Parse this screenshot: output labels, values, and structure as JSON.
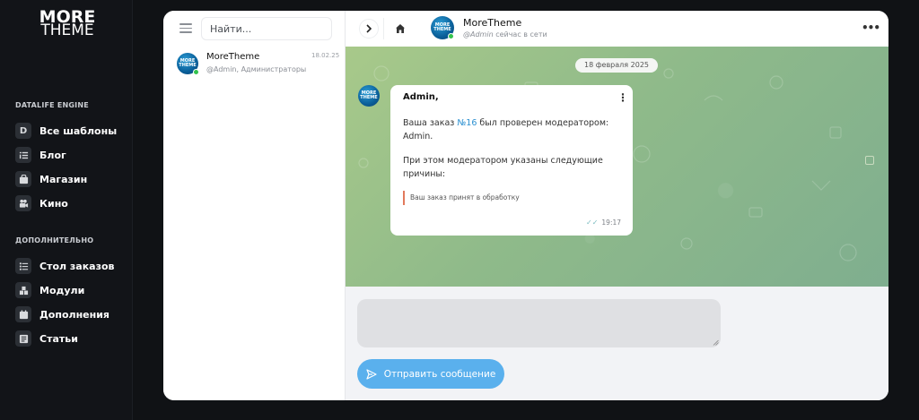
{
  "brand": {
    "logo_line1": "MORE",
    "logo_line2": "THEME"
  },
  "sidebar": {
    "section1_title": "DATALIFE ENGINE",
    "section1_items": [
      {
        "label": "Все шаблоны",
        "icon": "letter-d-icon",
        "glyph": "D"
      },
      {
        "label": "Блог",
        "icon": "list-icon"
      },
      {
        "label": "Магазин",
        "icon": "shop-icon"
      },
      {
        "label": "Кино",
        "icon": "video-camera-icon"
      }
    ],
    "section2_title": "ДОПОЛНИТЕЛЬНО",
    "section2_items": [
      {
        "label": "Стол заказов",
        "icon": "orders-list-icon"
      },
      {
        "label": "Модули",
        "icon": "modules-icon"
      },
      {
        "label": "Дополнения",
        "icon": "calendar-icon"
      },
      {
        "label": "Статьи",
        "icon": "article-icon"
      }
    ]
  },
  "chatlist": {
    "search_placeholder": "Найти...",
    "entries": [
      {
        "name": "MoreTheme",
        "subtitle": "@Admin, Администраторы",
        "time": "18.02.25",
        "avatar_text": "MORE THEME"
      }
    ]
  },
  "conversation": {
    "title": "MoreTheme",
    "status_user": "@Admin",
    "status_text": "сейчас в сети",
    "avatar_text": "MORE THEME",
    "date_separator": "18 февраля 2025",
    "messages": [
      {
        "from": "Admin,",
        "line1_pre": "Ваша заказ ",
        "order_link": "№16",
        "line1_post": " был проверен модератором: Admin.",
        "line2": "При этом модератором указаны следующие причины:",
        "quote": "Ваш заказ принят в обработку",
        "time": "19:17",
        "check": "✓✓"
      }
    ]
  },
  "composer": {
    "input_value": "",
    "send_label": "Отправить сообщение"
  },
  "colors": {
    "accent": "#5ab0ed",
    "online": "#33c24d",
    "quote_bar": "#e27a5c",
    "sidebar_bg": "#121418"
  }
}
